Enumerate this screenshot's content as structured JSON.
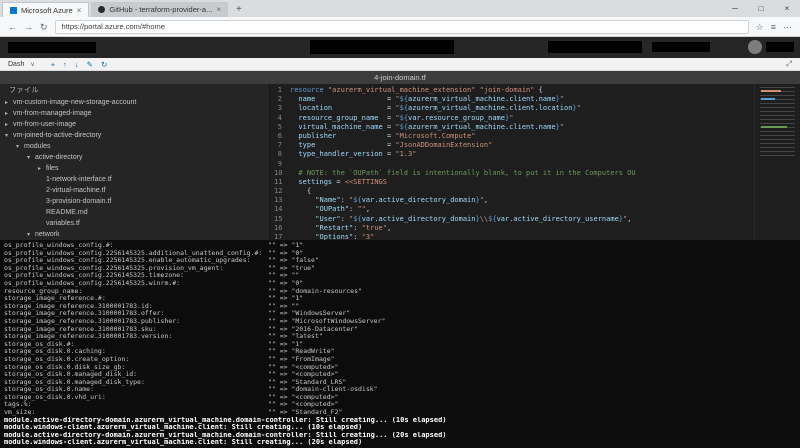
{
  "browser": {
    "tabs": [
      {
        "title": "Microsoft Azure"
      },
      {
        "title": "GitHub - terraform-provider-a..."
      }
    ],
    "url": "https://portal.azure.com/#home",
    "window_controls": {
      "minimize": "─",
      "maximize": "□",
      "close": "×"
    },
    "nav": {
      "back": "←",
      "forward": "→",
      "refresh": "↻"
    },
    "actions": {
      "favorites": "☆",
      "hub": "≡",
      "more": "⋯",
      "new_tab": "+",
      "close_tab": "×"
    }
  },
  "azure": {
    "dashboard_label": "Dash",
    "chevron": "∨",
    "fullscreen": "⤢",
    "toolbar_icons": [
      {
        "name": "new-dashboard-icon",
        "glyph": "+"
      },
      {
        "name": "upload-icon",
        "glyph": "↑"
      },
      {
        "name": "download-icon",
        "glyph": "↓"
      },
      {
        "name": "edit-icon",
        "glyph": "✎"
      },
      {
        "name": "refresh-icon",
        "glyph": "↻"
      }
    ]
  },
  "editor": {
    "window_title": "4-join-domain.tf",
    "explorer_title": "ファイル",
    "tree": [
      {
        "label": "vm-custom-image-new-storage-account",
        "indent": 0,
        "state": "collapsed"
      },
      {
        "label": "vm-from-managed-image",
        "indent": 0,
        "state": "collapsed"
      },
      {
        "label": "vm-from-user-image",
        "indent": 0,
        "state": "collapsed"
      },
      {
        "label": "vm-joined-to-active-directory",
        "indent": 0,
        "state": "expanded"
      },
      {
        "label": "modules",
        "indent": 1,
        "state": "expanded"
      },
      {
        "label": "active-directory",
        "indent": 2,
        "state": "expanded"
      },
      {
        "label": "files",
        "indent": 3,
        "state": "collapsed"
      },
      {
        "label": "1-network-interface.tf",
        "indent": 3,
        "state": "none"
      },
      {
        "label": "2-virtual-machine.tf",
        "indent": 3,
        "state": "none"
      },
      {
        "label": "3-provision-domain.tf",
        "indent": 3,
        "state": "none"
      },
      {
        "label": "README.md",
        "indent": 3,
        "state": "none"
      },
      {
        "label": "variables.tf",
        "indent": 3,
        "state": "none"
      },
      {
        "label": "network",
        "indent": 2,
        "state": "expanded"
      }
    ],
    "code": [
      {
        "n": "1",
        "seg": [
          [
            "kw",
            "resource"
          ],
          [
            "pl",
            " "
          ],
          [
            "str",
            "\"azurerm_virtual_machine_extension\""
          ],
          [
            "pl",
            " "
          ],
          [
            "str",
            "\"join-domain\""
          ],
          [
            "pl",
            " {"
          ]
        ]
      },
      {
        "n": "2",
        "seg": [
          [
            "prop",
            "  name"
          ],
          [
            "pl",
            "                 "
          ],
          [
            "op",
            "= "
          ],
          [
            "str",
            "\""
          ],
          [
            "interp",
            "${"
          ],
          [
            "var",
            "azurerm_virtual_machine.client.name"
          ],
          [
            "interp",
            "}"
          ],
          [
            "str",
            "\""
          ]
        ]
      },
      {
        "n": "3",
        "seg": [
          [
            "prop",
            "  location"
          ],
          [
            "pl",
            "             "
          ],
          [
            "op",
            "= "
          ],
          [
            "str",
            "\""
          ],
          [
            "interp",
            "${"
          ],
          [
            "var",
            "azurerm_virtual_machine.client.location"
          ],
          [
            "interp",
            "}"
          ],
          [
            "str",
            "\""
          ]
        ]
      },
      {
        "n": "4",
        "seg": [
          [
            "prop",
            "  resource_group_name"
          ],
          [
            "pl",
            "  "
          ],
          [
            "op",
            "= "
          ],
          [
            "str",
            "\""
          ],
          [
            "interp",
            "${"
          ],
          [
            "var",
            "var.resource_group_name"
          ],
          [
            "interp",
            "}"
          ],
          [
            "str",
            "\""
          ]
        ]
      },
      {
        "n": "5",
        "seg": [
          [
            "prop",
            "  virtual_machine_name"
          ],
          [
            "pl",
            " "
          ],
          [
            "op",
            "= "
          ],
          [
            "str",
            "\""
          ],
          [
            "interp",
            "${"
          ],
          [
            "var",
            "azurerm_virtual_machine.client.name"
          ],
          [
            "interp",
            "}"
          ],
          [
            "str",
            "\""
          ]
        ]
      },
      {
        "n": "6",
        "seg": [
          [
            "prop",
            "  publisher"
          ],
          [
            "pl",
            "            "
          ],
          [
            "op",
            "= "
          ],
          [
            "str",
            "\"Microsoft.Compute\""
          ]
        ]
      },
      {
        "n": "7",
        "seg": [
          [
            "prop",
            "  type"
          ],
          [
            "pl",
            "                 "
          ],
          [
            "op",
            "= "
          ],
          [
            "str",
            "\"JsonADDomainExtension\""
          ]
        ]
      },
      {
        "n": "8",
        "seg": [
          [
            "prop",
            "  type_handler_version"
          ],
          [
            "pl",
            " "
          ],
          [
            "op",
            "= "
          ],
          [
            "str",
            "\"1.3\""
          ]
        ]
      },
      {
        "n": "9",
        "seg": [
          [
            "pl",
            ""
          ]
        ]
      },
      {
        "n": "10",
        "seg": [
          [
            "cm",
            "  # NOTE: the `OUPath` field is intentionally blank, to put it in the Computers OU"
          ]
        ]
      },
      {
        "n": "11",
        "seg": [
          [
            "prop",
            "  settings"
          ],
          [
            "op",
            " = "
          ],
          [
            "str",
            "<<SETTINGS"
          ]
        ]
      },
      {
        "n": "12",
        "seg": [
          [
            "pl",
            "    {"
          ]
        ]
      },
      {
        "n": "13",
        "seg": [
          [
            "pl",
            "      "
          ],
          [
            "prop",
            "\"Name\""
          ],
          [
            "pl",
            ": "
          ],
          [
            "str",
            "\""
          ],
          [
            "interp",
            "${"
          ],
          [
            "var",
            "var.active_directory_domain"
          ],
          [
            "interp",
            "}"
          ],
          [
            "str",
            "\""
          ],
          [
            "pl",
            ","
          ]
        ]
      },
      {
        "n": "14",
        "seg": [
          [
            "pl",
            "      "
          ],
          [
            "prop",
            "\"OUPath\""
          ],
          [
            "pl",
            ": "
          ],
          [
            "str",
            "\"\""
          ],
          [
            "pl",
            ","
          ]
        ]
      },
      {
        "n": "15",
        "seg": [
          [
            "pl",
            "      "
          ],
          [
            "prop",
            "\"User\""
          ],
          [
            "pl",
            ": "
          ],
          [
            "str",
            "\""
          ],
          [
            "interp",
            "${"
          ],
          [
            "var",
            "var.active_directory_domain"
          ],
          [
            "interp",
            "}"
          ],
          [
            "str",
            "\\\\"
          ],
          [
            "interp",
            "${"
          ],
          [
            "var",
            "var.active_directory_username"
          ],
          [
            "interp",
            "}"
          ],
          [
            "str",
            "\""
          ],
          [
            "pl",
            ","
          ]
        ]
      },
      {
        "n": "16",
        "seg": [
          [
            "pl",
            "      "
          ],
          [
            "prop",
            "\"Restart\""
          ],
          [
            "pl",
            ": "
          ],
          [
            "str",
            "\"true\""
          ],
          [
            "pl",
            ","
          ]
        ]
      },
      {
        "n": "17",
        "seg": [
          [
            "pl",
            "      "
          ],
          [
            "prop",
            "\"Options\""
          ],
          [
            "pl",
            ": "
          ],
          [
            "str",
            "\"3\""
          ]
        ]
      }
    ]
  },
  "terminal": {
    "diff_lines": [
      {
        "k": "os_profile_windows_config.#:",
        "v": "\"\" => \"1\""
      },
      {
        "k": "os_profile_windows_config.2256145325.additional_unattend_config.#:",
        "v": "\"\" => \"0\""
      },
      {
        "k": "os_profile_windows_config.2256145325.enable_automatic_upgrades:",
        "v": "\"\" => \"false\""
      },
      {
        "k": "os_profile_windows_config.2256145325.provision_vm_agent:",
        "v": "\"\" => \"true\""
      },
      {
        "k": "os_profile_windows_config.2256145325.timezone:",
        "v": "\"\" => \"\""
      },
      {
        "k": "os_profile_windows_config.2256145325.winrm.#:",
        "v": "\"\" => \"0\""
      },
      {
        "k": "resource_group_name:",
        "v": "\"\" => \"domain-resources\""
      },
      {
        "k": "storage_image_reference.#:",
        "v": "\"\" => \"1\""
      },
      {
        "k": "storage_image_reference.3100001783.id:",
        "v": "\"\" => \"\""
      },
      {
        "k": "storage_image_reference.3100001783.offer:",
        "v": "\"\" => \"WindowsServer\""
      },
      {
        "k": "storage_image_reference.3100001783.publisher:",
        "v": "\"\" => \"MicrosoftWindowsServer\""
      },
      {
        "k": "storage_image_reference.3100001783.sku:",
        "v": "\"\" => \"2016-Datacenter\""
      },
      {
        "k": "storage_image_reference.3100001783.version:",
        "v": "\"\" => \"latest\""
      },
      {
        "k": "storage_os_disk.#:",
        "v": "\"\" => \"1\""
      },
      {
        "k": "storage_os_disk.0.caching:",
        "v": "\"\" => \"ReadWrite\""
      },
      {
        "k": "storage_os_disk.0.create_option:",
        "v": "\"\" => \"FromImage\""
      },
      {
        "k": "storage_os_disk.0.disk_size_gb:",
        "v": "\"\" => \"<computed>\""
      },
      {
        "k": "storage_os_disk.0.managed_disk_id:",
        "v": "\"\" => \"<computed>\""
      },
      {
        "k": "storage_os_disk.0.managed_disk_type:",
        "v": "\"\" => \"Standard_LRS\""
      },
      {
        "k": "storage_os_disk.0.name:",
        "v": "\"\" => \"domain-client-osdisk\""
      },
      {
        "k": "storage_os_disk.0.vhd_uri:",
        "v": "\"\" => \"<computed>\""
      },
      {
        "k": "tags.%:",
        "v": "\"\" => \"<computed>\""
      },
      {
        "k": "vm_size:",
        "v": "\"\" => \"Standard_F2\""
      }
    ],
    "status_lines": [
      "module.active-directory-domain.azurerm_virtual_machine.domain-controller: Still creating... (10s elapsed)",
      "module.windows-client.azurerm_virtual_machine.client: Still creating... (10s elapsed)",
      "module.active-directory-domain.azurerm_virtual_machine.domain-controller: Still creating... (20s elapsed)",
      "module.windows-client.azurerm_virtual_machine.client: Still creating... (20s elapsed)"
    ]
  }
}
